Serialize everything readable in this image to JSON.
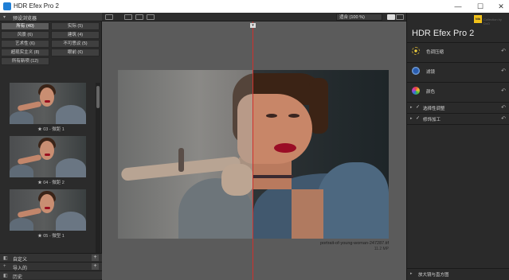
{
  "window": {
    "title": "HDR Efex Pro 2",
    "minimize": "—",
    "maximize": "☐",
    "close": "✕"
  },
  "left_panel": {
    "header": "预设浏览器",
    "categories": [
      {
        "label": "所有 (40)",
        "active": true
      },
      {
        "label": "实际 (5)",
        "active": false
      },
      {
        "label": "风景 (6)",
        "active": false
      },
      {
        "label": "建筑 (4)",
        "active": false
      },
      {
        "label": "艺术性 (6)",
        "active": false
      },
      {
        "label": "不可思议 (5)",
        "active": false
      },
      {
        "label": "超现实主义 (8)",
        "active": false
      },
      {
        "label": "眼前 (6)",
        "active": false
      },
      {
        "label": "所有新项 (12)",
        "active": false
      }
    ],
    "thumbnails": [
      {
        "caption": "★ 03 - 微距 1"
      },
      {
        "caption": "★ 04 - 微距 2"
      },
      {
        "caption": "★ 05 - 微型 1"
      }
    ],
    "footer": [
      {
        "icon": "◧",
        "label": "自定义"
      },
      {
        "icon": "+",
        "label": "导入的"
      },
      {
        "icon": "◧",
        "label": "历史"
      }
    ]
  },
  "toolbar": {
    "zoom_label": "适合 (100 %)"
  },
  "canvas": {
    "filename": "portrait-of-young-woman-247287.tif",
    "filesize": "11.2 MP"
  },
  "right_panel": {
    "nik_label": "Nik",
    "nik_text": "Collection by DxO",
    "title": "HDR Efex Pro 2",
    "sections": [
      {
        "icon": "tone-compression-icon",
        "label": "色调压缩",
        "reset": "↶"
      },
      {
        "icon": "method-icon",
        "label": "滤镜",
        "reset": "↶"
      },
      {
        "icon": "color-icon",
        "label": "颜色",
        "reset": "↶"
      }
    ],
    "subsections": [
      {
        "label": "选择性调整",
        "reset": "↶"
      },
      {
        "label": "修饰加工",
        "reset": "↶"
      }
    ],
    "footer": "放大镜与直方图"
  }
}
